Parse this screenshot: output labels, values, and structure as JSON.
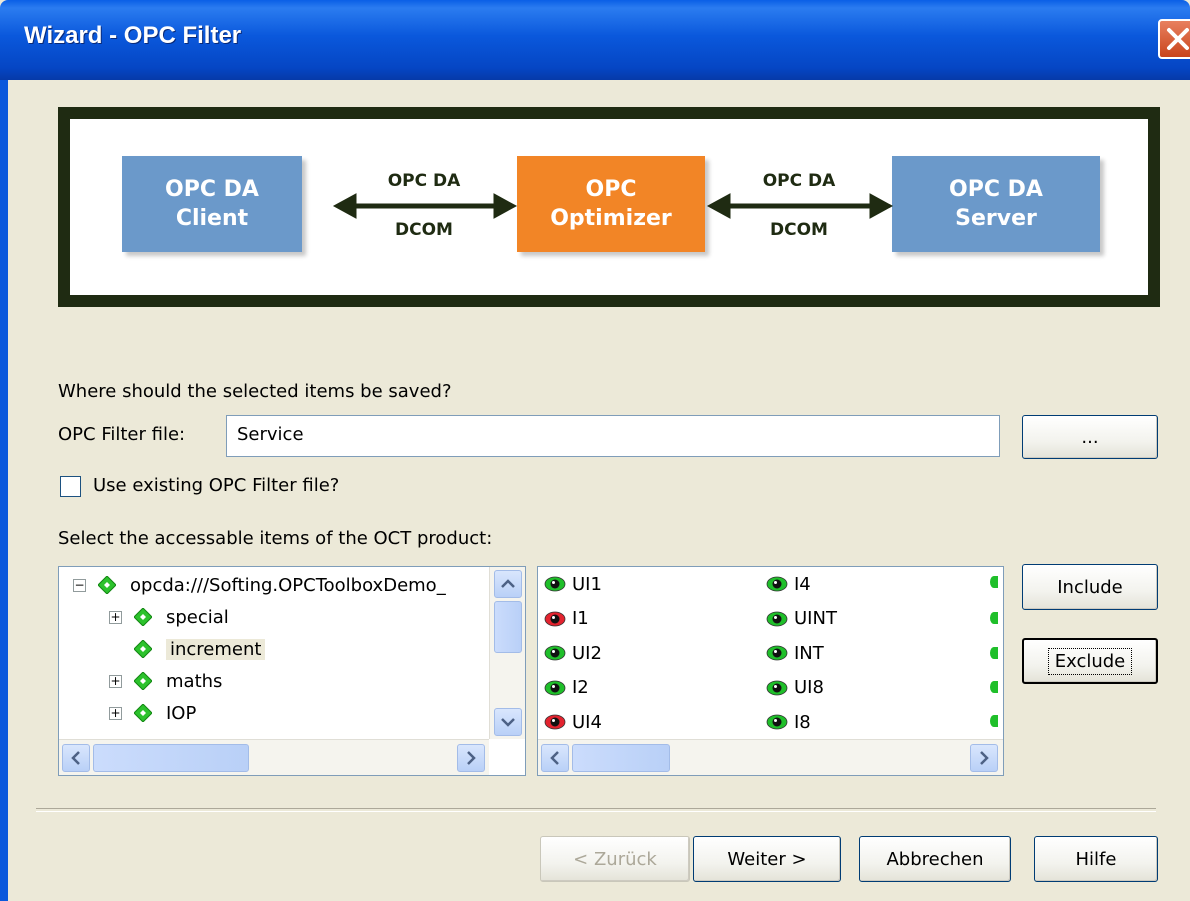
{
  "window": {
    "title": "Wizard - OPC Filter"
  },
  "diagram": {
    "client_line1": "OPC DA",
    "client_line2": "Client",
    "optimizer_line1": "OPC",
    "optimizer_line2": "Optimizer",
    "server_line1": "OPC DA",
    "server_line2": "Server",
    "left_link_top": "OPC DA",
    "left_link_bottom": "DCOM",
    "right_link_top": "OPC DA",
    "right_link_bottom": "DCOM",
    "colors": {
      "box_blue": "#6b99ca",
      "box_orange": "#f28526",
      "frame": "#1f2b12"
    }
  },
  "form": {
    "question": "Where should the selected items be saved?",
    "file_label": "OPC Filter file:",
    "file_value": "Service",
    "browse_label": "...",
    "use_existing_label": "Use existing OPC Filter file?",
    "use_existing_checked": false,
    "select_label": "Select the accessable items of the OCT product:"
  },
  "tree": {
    "root": "opcda:///Softing.OPCToolboxDemo_",
    "children": [
      {
        "label": "special",
        "expandable": true
      },
      {
        "label": "increment",
        "expandable": false,
        "selected": true
      },
      {
        "label": "maths",
        "expandable": true
      },
      {
        "label": "IOP",
        "expandable": true
      }
    ]
  },
  "items": {
    "column1": [
      {
        "label": "UI1",
        "status": "included"
      },
      {
        "label": "I1",
        "status": "excluded"
      },
      {
        "label": "UI2",
        "status": "included"
      },
      {
        "label": "I2",
        "status": "included"
      },
      {
        "label": "UI4",
        "status": "excluded"
      }
    ],
    "column2": [
      {
        "label": "I4",
        "status": "included"
      },
      {
        "label": "UINT",
        "status": "included"
      },
      {
        "label": "INT",
        "status": "included"
      },
      {
        "label": "UI8",
        "status": "included"
      },
      {
        "label": "I8",
        "status": "included"
      }
    ],
    "status_colors": {
      "included": "#1fbf2a",
      "excluded": "#e3232f"
    }
  },
  "actions": {
    "include": "Include",
    "exclude": "Exclude"
  },
  "nav": {
    "back": "< Zurück",
    "next": "Weiter >",
    "cancel": "Abbrechen",
    "help": "Hilfe"
  }
}
